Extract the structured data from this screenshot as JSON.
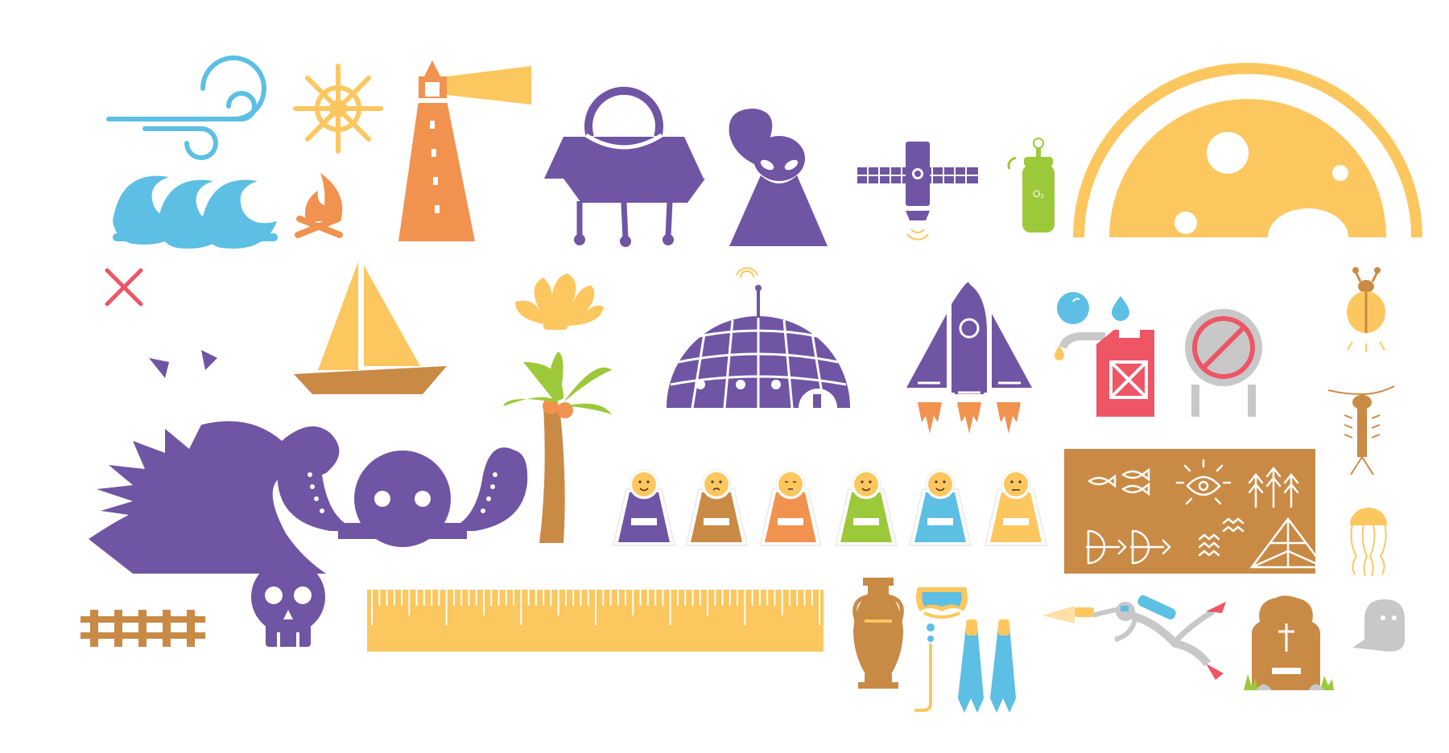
{
  "palette": {
    "purple": "#6f55a3",
    "yellow": "#fdc75f",
    "orange": "#f1924f",
    "blue": "#5cbfe3",
    "green": "#9cc93a",
    "brown": "#c98a45",
    "red": "#ee5565",
    "gray": "#c8c8c8",
    "white": "#ffffff"
  },
  "icons": [
    "wind-icon",
    "ships-wheel-icon",
    "lighthouse-icon",
    "ufo-icon",
    "alien-icon",
    "satellite-icon",
    "oxygen-tank-icon",
    "planet-icon",
    "waves-icon",
    "campfire-icon",
    "x-mark-icon",
    "sailboat-icon",
    "seashell-icon",
    "dome-base-icon",
    "rocket-icon",
    "water-drops-icon",
    "fuel-can-icon",
    "no-entry-sign-icon",
    "firefly-icon",
    "sea-monster-icon",
    "octopus-icon",
    "palm-tree-icon",
    "player-pawns-icon",
    "cave-paintings-icon",
    "shrimp-icon",
    "jellyfish-icon",
    "wooden-fence-icon",
    "skull-icon",
    "ruler-icon",
    "amphora-icon",
    "snorkel-gear-icon",
    "diver-icon",
    "gravestone-icon",
    "ghost-icon"
  ],
  "oxygen_tank": {
    "label": "O₂"
  },
  "pawns": {
    "colors": [
      "#6f55a3",
      "#c98a45",
      "#f1924f",
      "#9cc93a",
      "#5cbfe3",
      "#fdc75f"
    ],
    "faces": [
      "happy",
      "worried",
      "sleepy",
      "happy",
      "happy",
      "sad"
    ]
  }
}
